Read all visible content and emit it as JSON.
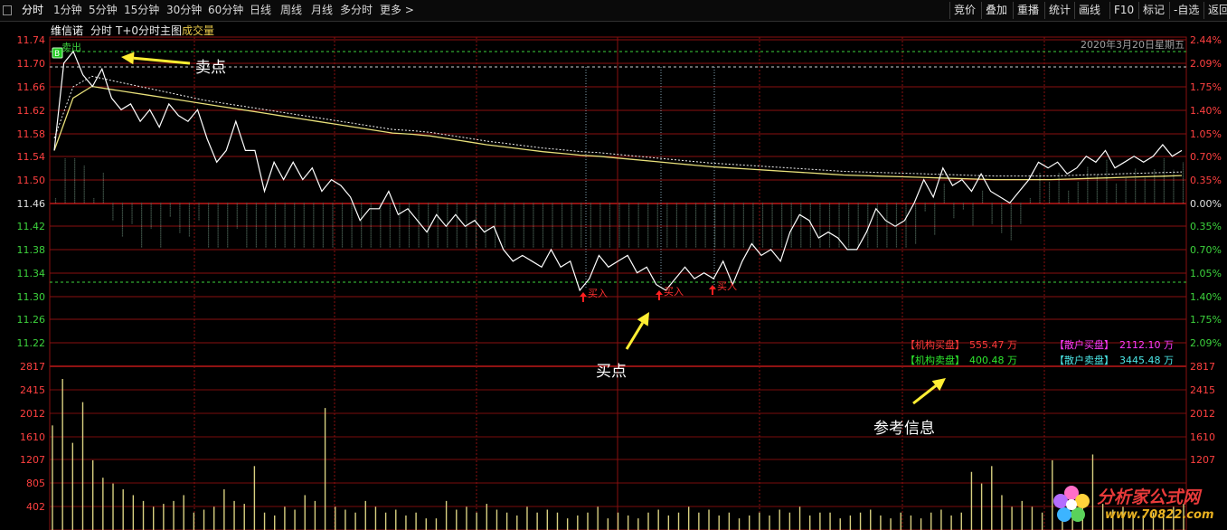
{
  "toolbar": {
    "tabs": [
      "分时",
      "1分钟",
      "5分钟",
      "15分钟",
      "30分钟",
      "60分钟",
      "日线",
      "周线",
      "月线",
      "多分时",
      "更多 >"
    ],
    "active_tab": 0,
    "right_buttons": [
      "竞价",
      "叠加",
      "重播",
      "统计",
      "画线",
      "F10",
      "标记",
      "-自选",
      "返回"
    ]
  },
  "subheader": {
    "stock_name": "维信诺",
    "mode": "分时",
    "main_chart": "T+0分时主图",
    "volume_label": "成交量"
  },
  "date_label": "2020年3月20日星期五",
  "price_axis": {
    "left_labels": [
      "11.74",
      "11.70",
      "11.66",
      "11.62",
      "11.58",
      "11.54",
      "11.50",
      "11.46",
      "11.42",
      "11.38",
      "11.34",
      "11.30",
      "11.26",
      "11.22"
    ],
    "right_labels": [
      "2.44%",
      "2.09%",
      "1.75%",
      "1.40%",
      "1.05%",
      "0.70%",
      "0.35%",
      "0.00%",
      "0.35%",
      "0.70%",
      "1.05%",
      "1.40%",
      "1.75%",
      "2.09%"
    ]
  },
  "volume_axis": {
    "left_labels": [
      "2817",
      "2415",
      "2012",
      "1610",
      "1207",
      "805",
      "402"
    ],
    "right_labels": [
      "2817",
      "2415",
      "2012",
      "1610",
      "1207"
    ]
  },
  "signals": {
    "sell_label": "卖出",
    "sell_icon_text": "B",
    "buy_label": "买入"
  },
  "annotations": {
    "sell_point": "卖点",
    "buy_point": "买点",
    "reference": "参考信息"
  },
  "info_panel": {
    "inst_buy_label": "【机构买盘】",
    "inst_buy_value": "555.47 万",
    "retail_buy_label": "【散户买盘】",
    "retail_buy_value": "2112.10 万",
    "inst_sell_label": "【机构卖盘】",
    "inst_sell_value": "400.48 万",
    "retail_sell_label": "【散户卖盘】",
    "retail_sell_value": "3445.48 万"
  },
  "watermark": {
    "name": "分析家公式网",
    "url": "www.70822.com"
  },
  "chart_data": {
    "type": "line",
    "prev_close": 11.46,
    "price_range": [
      11.2,
      11.76
    ],
    "volume_max": 2817,
    "price": [
      11.55,
      11.7,
      11.72,
      11.68,
      11.66,
      11.69,
      11.64,
      11.62,
      11.63,
      11.6,
      11.62,
      11.59,
      11.63,
      11.61,
      11.6,
      11.62,
      11.57,
      11.53,
      11.55,
      11.6,
      11.55,
      11.55,
      11.48,
      11.53,
      11.5,
      11.53,
      11.5,
      11.52,
      11.48,
      11.5,
      11.49,
      11.47,
      11.43,
      11.45,
      11.45,
      11.48,
      11.44,
      11.45,
      11.43,
      11.41,
      11.44,
      11.42,
      11.44,
      11.42,
      11.43,
      11.41,
      11.42,
      11.38,
      11.36,
      11.37,
      11.36,
      11.35,
      11.38,
      11.35,
      11.36,
      11.31,
      11.33,
      11.37,
      11.35,
      11.36,
      11.37,
      11.34,
      11.35,
      11.32,
      11.31,
      11.33,
      11.35,
      11.33,
      11.34,
      11.33,
      11.36,
      11.32,
      11.36,
      11.39,
      11.37,
      11.38,
      11.36,
      11.41,
      11.44,
      11.43,
      11.4,
      11.41,
      11.4,
      11.38,
      11.38,
      11.41,
      11.45,
      11.43,
      11.42,
      11.43,
      11.46,
      11.5,
      11.47,
      11.52,
      11.49,
      11.5,
      11.48,
      11.51,
      11.48,
      11.47,
      11.46,
      11.48,
      11.5,
      11.53,
      11.52,
      11.53,
      11.51,
      11.52,
      11.54,
      11.53,
      11.55,
      11.52,
      11.53,
      11.54,
      11.53,
      11.54,
      11.56,
      11.54,
      11.55
    ],
    "avg": [
      11.55,
      11.64,
      11.66,
      11.655,
      11.65,
      11.645,
      11.64,
      11.635,
      11.63,
      11.625,
      11.62,
      11.615,
      11.61,
      11.605,
      11.6,
      11.595,
      11.59,
      11.585,
      11.58,
      11.578,
      11.575,
      11.57,
      11.565,
      11.56,
      11.556,
      11.552,
      11.548,
      11.545,
      11.542,
      11.54,
      11.537,
      11.534,
      11.531,
      11.528,
      11.525,
      11.522,
      11.52,
      11.518,
      11.516,
      11.514,
      11.512,
      11.51,
      11.508,
      11.507,
      11.506,
      11.505,
      11.504,
      11.503,
      11.502,
      11.501,
      11.5,
      11.5,
      11.5,
      11.5,
      11.501,
      11.502,
      11.503,
      11.504,
      11.505,
      11.506,
      11.507
    ],
    "volume": [
      1800,
      2600,
      1500,
      2200,
      1200,
      900,
      800,
      700,
      600,
      500,
      400,
      450,
      500,
      600,
      300,
      350,
      400,
      700,
      500,
      450,
      1100,
      300,
      250,
      400,
      350,
      600,
      500,
      2100,
      400,
      350,
      300,
      500,
      400,
      300,
      350,
      250,
      300,
      200,
      200,
      500,
      350,
      400,
      300,
      450,
      350,
      300,
      250,
      400,
      300,
      350,
      300,
      200,
      250,
      300,
      400,
      200,
      300,
      250,
      200,
      300,
      350,
      250,
      300,
      400,
      300,
      350,
      250,
      300,
      200,
      250,
      300,
      250,
      350,
      300,
      400,
      250,
      300,
      300,
      200,
      250,
      300,
      350,
      250,
      200,
      300,
      250,
      200,
      300,
      350,
      250,
      300,
      1000,
      800,
      1100,
      600,
      400,
      500,
      400,
      300,
      1200,
      300,
      350,
      400,
      1300,
      450,
      350,
      400,
      300,
      250,
      300,
      350,
      400,
      450
    ]
  }
}
